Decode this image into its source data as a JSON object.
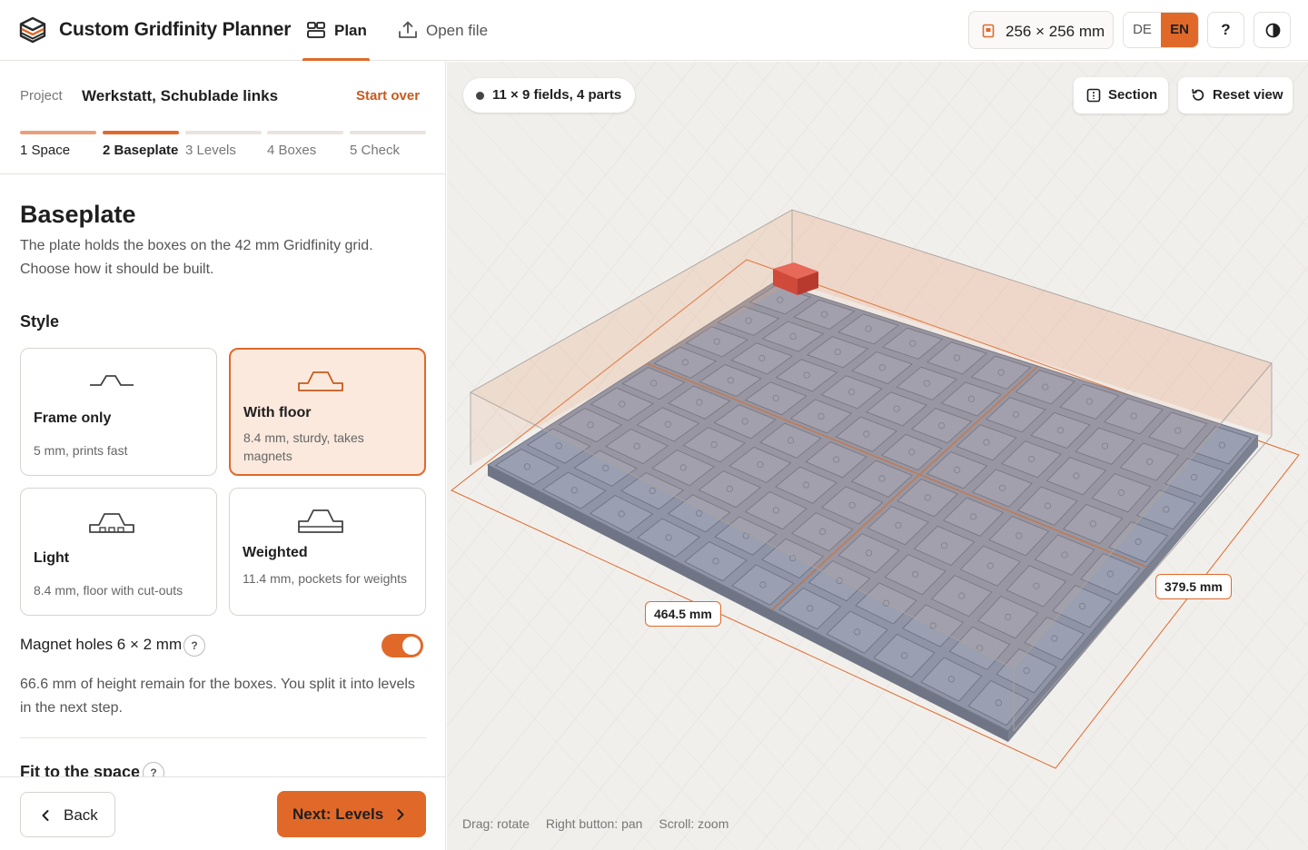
{
  "header": {
    "app_title": "Custom Gridfinity Planner",
    "nav_plan": "Plan",
    "nav_open_file": "Open file",
    "printer_size": "256 × 256 mm",
    "languages": [
      "DE",
      "EN"
    ],
    "active_language": "EN",
    "help_label": "?",
    "accent_color": "#e0692a"
  },
  "project": {
    "label": "Project",
    "name": "Werkstatt, Schublade links",
    "start_over": "Start over"
  },
  "steps": [
    {
      "label": "1  Space",
      "state": "done"
    },
    {
      "label": "2  Baseplate",
      "state": "active"
    },
    {
      "label": "3  Levels",
      "state": "todo"
    },
    {
      "label": "4  Boxes",
      "state": "todo"
    },
    {
      "label": "5  Check",
      "state": "todo"
    }
  ],
  "baseplate": {
    "title": "Baseplate",
    "description": "The plate holds the boxes on the 42 mm Gridfinity grid. Choose how it should be built.",
    "style_title": "Style",
    "styles": [
      {
        "name": "Frame only",
        "sub": "5 mm, prints fast",
        "selected": false
      },
      {
        "name": "With floor",
        "sub": "8.4 mm, sturdy, takes magnets",
        "selected": true
      },
      {
        "name": "Light",
        "sub": "8.4 mm, floor with cut-outs",
        "selected": false
      },
      {
        "name": "Weighted",
        "sub": "11.4 mm, pockets for weights",
        "selected": false
      }
    ],
    "magnet_label": "Magnet holes 6 × 2 mm",
    "magnet_help": "?",
    "magnet_enabled": true,
    "remaining_text": "66.6 mm of height remain for the boxes. You split it into levels in the next step.",
    "fit_title": "Fit to the space",
    "fit_help": "?"
  },
  "footer": {
    "back": "Back",
    "next": "Next: Levels"
  },
  "viewport": {
    "summary": "11 × 9 fields, 4 parts",
    "section_btn": "Section",
    "reset_btn": "Reset view",
    "dim_length": "464.5 mm",
    "dim_width": "379.5 mm",
    "hint_drag": "Drag: rotate",
    "hint_right": "Right button: pan",
    "hint_scroll": "Scroll: zoom",
    "grid_cols": 11,
    "grid_rows": 9
  }
}
